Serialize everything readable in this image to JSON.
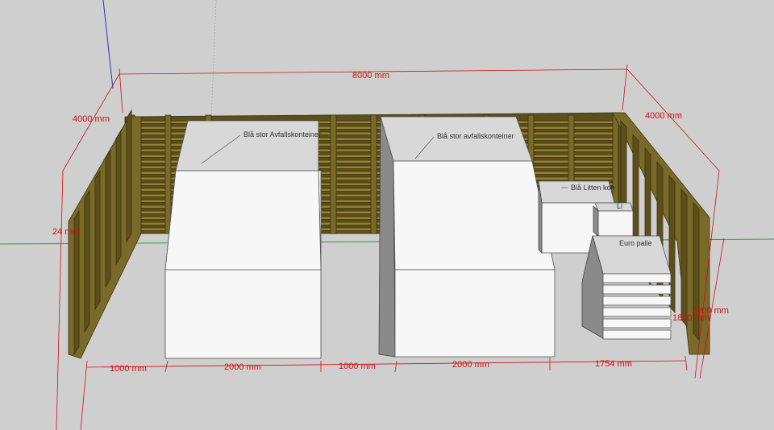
{
  "dimensions": {
    "total_length": "8000 mm",
    "left_depth": "4000 mm",
    "right_depth": "4000 mm",
    "left_height": "24 mm",
    "right_height_a": "2000 mm",
    "right_height_b": "1800 mm",
    "gap_left": "1000 mm",
    "container1_width": "2000 mm",
    "gap_middle": "1000 mm",
    "container2_width": "2000 mm",
    "gap_right": "1754 mm"
  },
  "labels": {
    "container1": "Blå stor Avfallskonteiner",
    "container2": "Blå stor avfallskonteiner",
    "small_container": "Blå Litten kon",
    "small_box": "Li",
    "pallet": "Euro palle"
  },
  "colors": {
    "dimension": "#d01010",
    "wood": "#7a6a2a",
    "background": "#cfcfcf"
  }
}
